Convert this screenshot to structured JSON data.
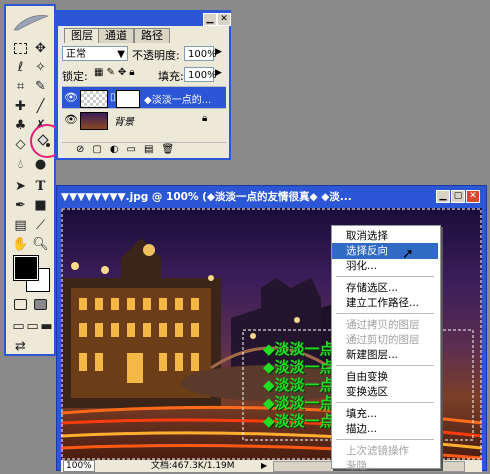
{
  "toolbox": {
    "tools": [
      "marquee",
      "move",
      "lasso",
      "magic-wand",
      "crop",
      "slice",
      "healing-brush",
      "brush",
      "clone-stamp",
      "history-brush",
      "eraser",
      "paint-bucket",
      "blur",
      "dodge",
      "path-select",
      "type",
      "pen",
      "shape",
      "notes",
      "eyedropper",
      "hand",
      "zoom"
    ]
  },
  "layers_palette": {
    "tabs": [
      "图层",
      "通道",
      "路径"
    ],
    "blend_mode": "正常",
    "opacity_label": "不透明度:",
    "opacity_value": "100%",
    "lock_label": "锁定:",
    "fill_label": "填充:",
    "fill_value": "100%",
    "layers": [
      {
        "name": "◆淡淡一点的...",
        "selected": true
      },
      {
        "name": "背景",
        "selected": false
      }
    ]
  },
  "document": {
    "title": "▼▼▼▼▼▼▼▼.jpg @ 100% (◆淡淡一点的友情很真◆ ◆淡...",
    "zoom": "100%",
    "doc_size": "文档:467.3K/1.19M",
    "green_text": "◆淡淡一点"
  },
  "context_menu": {
    "items": [
      {
        "label": "取消选择",
        "state": "normal"
      },
      {
        "label": "选择反向",
        "state": "selected"
      },
      {
        "label": "羽化...",
        "state": "normal"
      },
      {
        "sep": true
      },
      {
        "label": "存储选区...",
        "state": "normal"
      },
      {
        "label": "建立工作路径...",
        "state": "normal"
      },
      {
        "sep": true
      },
      {
        "label": "通过拷贝的图层",
        "state": "disabled"
      },
      {
        "label": "通过剪切的图层",
        "state": "disabled"
      },
      {
        "label": "新建图层...",
        "state": "normal"
      },
      {
        "sep": true
      },
      {
        "label": "自由变换",
        "state": "normal"
      },
      {
        "label": "变换选区",
        "state": "normal"
      },
      {
        "sep": true
      },
      {
        "label": "填充...",
        "state": "normal"
      },
      {
        "label": "描边...",
        "state": "normal"
      },
      {
        "sep": true
      },
      {
        "label": "上次滤镜操作",
        "state": "disabled"
      },
      {
        "label": "渐隐...",
        "state": "disabled"
      }
    ]
  },
  "colors": {
    "titlebar": "#2b57d6",
    "menu_highlight": "#316ac5",
    "highlight_circle": "#e3207c",
    "green_text": "#22dd22"
  }
}
